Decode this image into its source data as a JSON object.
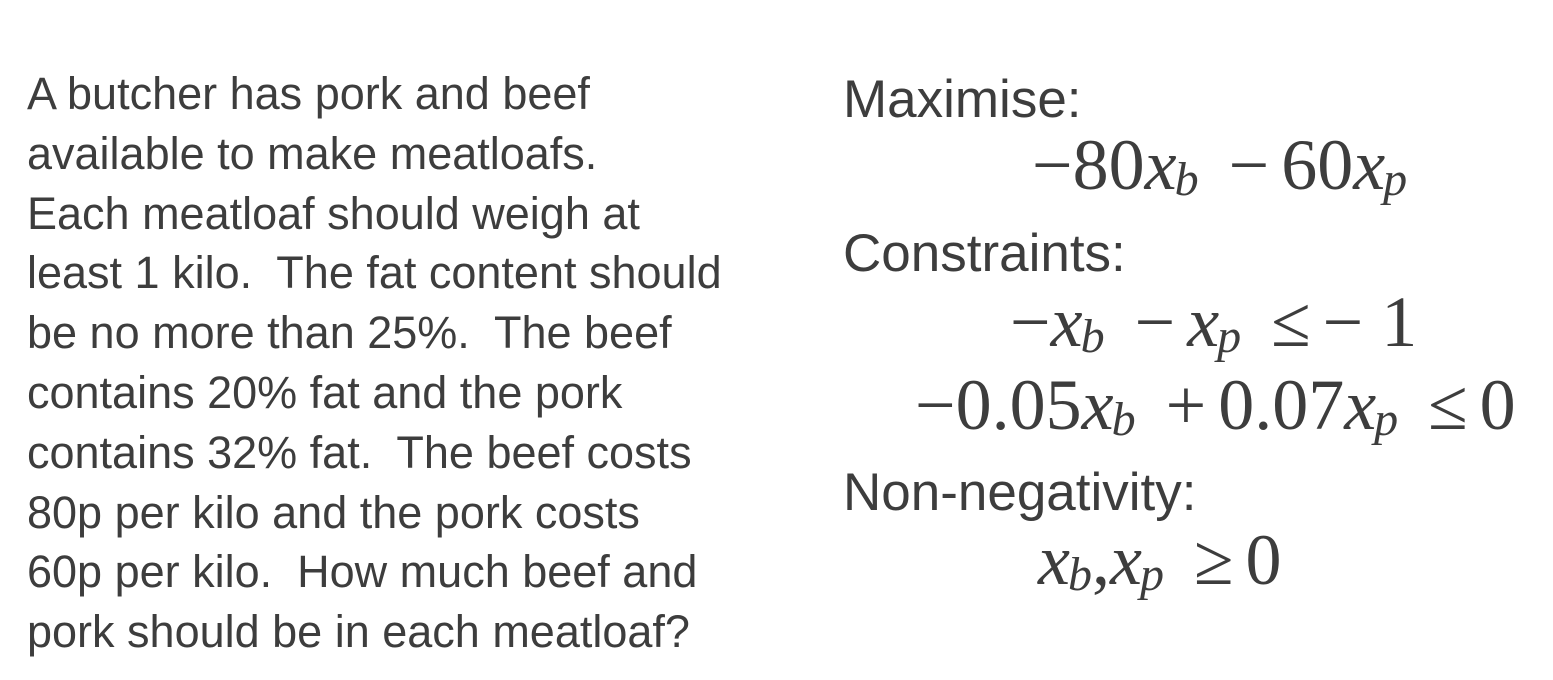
{
  "problem": {
    "lines": [
      "A butcher has pork and beef",
      "available to make meatloafs.",
      "Each meatloaf should weigh at",
      "least 1 kilo.  The fat content should",
      "be no more than 25%.  The beef",
      "contains 20% fat and the pork",
      "contains 32% fat.  The beef costs",
      "80p per kilo and the pork costs",
      "60p per kilo.  How much beef and",
      "pork should be in each meatloaf?"
    ]
  },
  "formulation": {
    "maximise_label": "Maximise:",
    "objective": {
      "coef_b": "−80",
      "var": "x",
      "sub_b": "b",
      "op": "−",
      "coef_p": "60",
      "sub_p": "p"
    },
    "constraints_label": "Constraints:",
    "constraint1": {
      "lead": "−",
      "var": "x",
      "sub_b": "b",
      "op": "−",
      "sub_p": "p",
      "rel": "≤",
      "rhs": "− 1"
    },
    "constraint2": {
      "coef_b": "−0.05",
      "var": "x",
      "sub_b": "b",
      "op": "+",
      "coef_p": "0.07",
      "sub_p": "p",
      "rel": "≤",
      "rhs": "0"
    },
    "nonneg_label": "Non-negativity:",
    "nonneg": {
      "var": "x",
      "sub_b": "b",
      "sep": ",",
      "sub_p": "p",
      "rel": "≥",
      "rhs": "0"
    }
  }
}
